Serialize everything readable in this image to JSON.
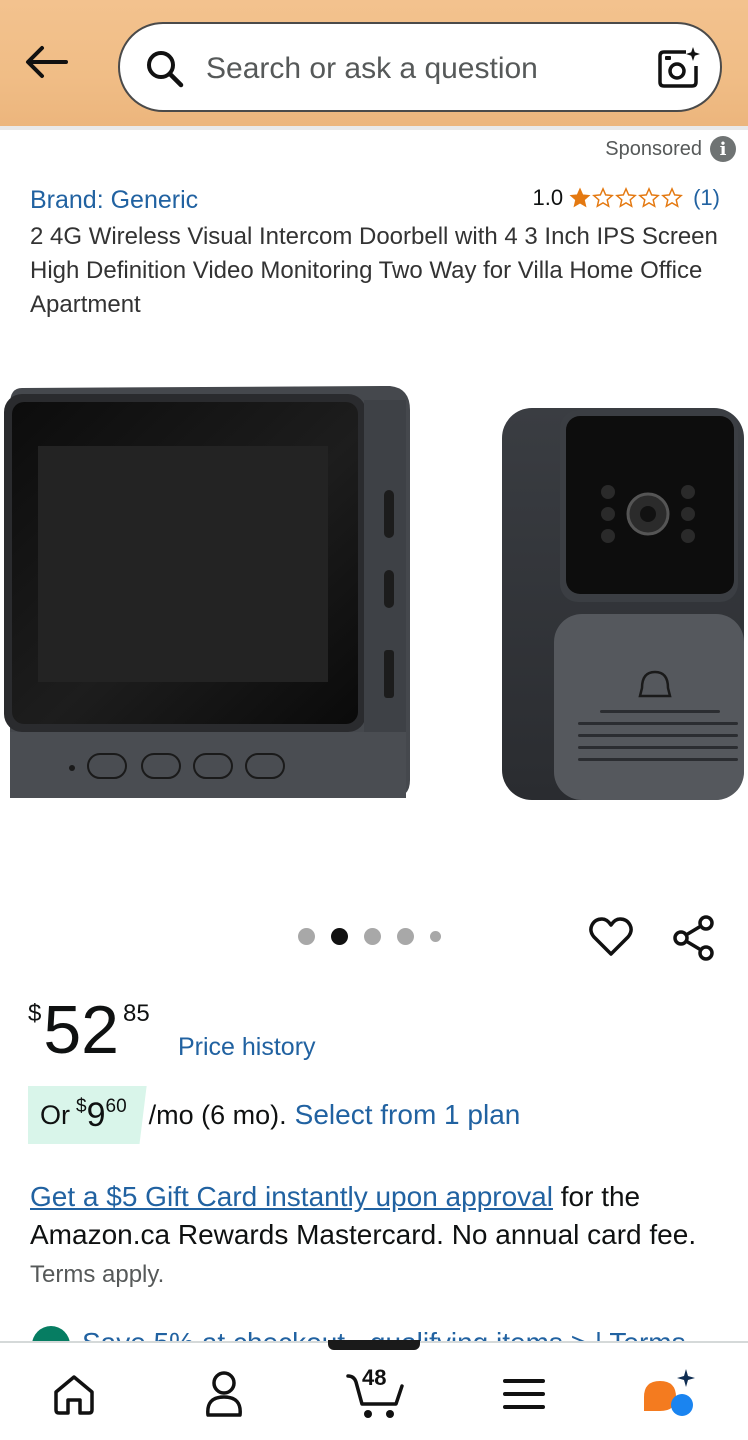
{
  "header": {
    "search_placeholder": "Search or ask a question"
  },
  "sponsored": {
    "label": "Sponsored"
  },
  "product": {
    "brand": "Brand: Generic",
    "rating": "1.0",
    "rating_value": 1.0,
    "rating_max": 5,
    "review_count": "(1)",
    "title": "2 4G Wireless Visual Intercom Doorbell with 4 3 Inch IPS Screen High Definition Video Monitoring Two Way for Villa Home Office Apartment"
  },
  "carousel": {
    "image_count": 5,
    "active_index": 1
  },
  "price": {
    "symbol": "$",
    "whole": "52",
    "fraction": "85",
    "history_label": "Price history"
  },
  "installment": {
    "prefix": "Or",
    "symbol": "$",
    "whole": "9",
    "fraction": "60",
    "suffix": "/mo (6 mo).",
    "link": "Select from 1 plan"
  },
  "promo": {
    "link": "Get a $5 Gift Card instantly upon approval",
    "text": " for the Amazon.ca Rewards Mastercard. No annual card fee.",
    "small": "Terms apply."
  },
  "save_offer": {
    "text": "Save 5% at checkout - qualifying items > | Terms"
  },
  "bottom_nav": {
    "cart_count": "48"
  },
  "colors": {
    "header_bg": "#f0bd86",
    "link": "#2162a1",
    "star": "#e47911",
    "installment_bg": "#d9f5ea",
    "save_check": "#067d62"
  }
}
